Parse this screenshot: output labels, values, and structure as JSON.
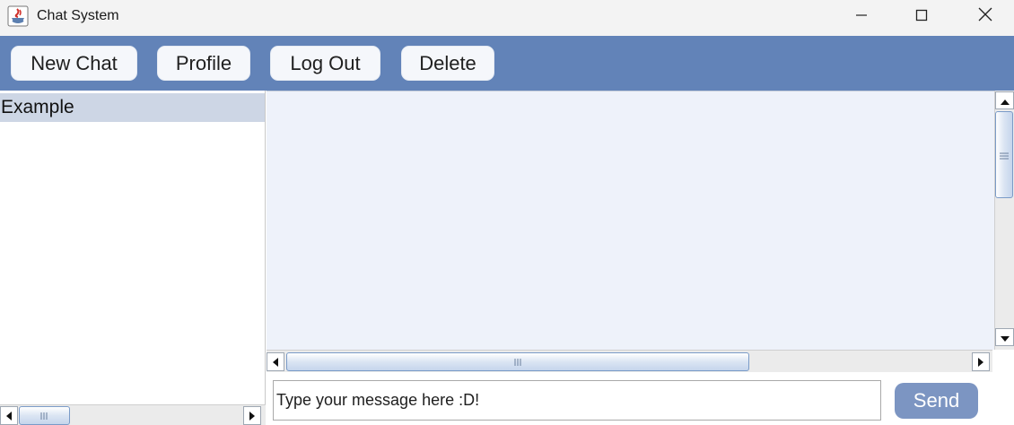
{
  "window": {
    "title": "Chat System",
    "icon": "java-coffee-cup-icon",
    "controls": [
      "minimize-icon",
      "maximize-icon",
      "close-icon"
    ]
  },
  "toolbar": {
    "background": "#6283b8",
    "new_chat_label": "New Chat",
    "profile_label": "Profile",
    "logout_label": "Log Out",
    "delete_label": "Delete"
  },
  "chat_list": {
    "items": [
      {
        "label": "Example",
        "selected": true
      }
    ],
    "selected_color": "#cdd6e5"
  },
  "chat_area": {
    "background": "#eef2fa",
    "messages": []
  },
  "composer": {
    "message_value": "Type your message here :D!",
    "send_label": "Send",
    "send_color": "#7c95c2"
  }
}
